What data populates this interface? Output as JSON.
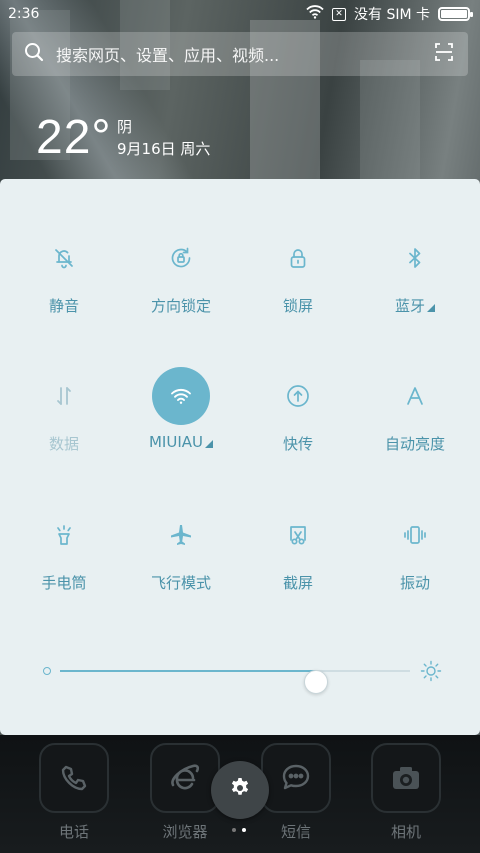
{
  "status_bar": {
    "time": "2:36",
    "carrier": "没有 SIM 卡",
    "battery_level": 1.0
  },
  "search": {
    "placeholder": "搜索网页、设置、应用、视频..."
  },
  "weather": {
    "temperature": "22°",
    "condition": "阴",
    "date": "9月16日 周六"
  },
  "quick_settings": {
    "tiles": [
      {
        "label": "静音",
        "icon": "bell-off-icon"
      },
      {
        "label": "方向锁定",
        "icon": "rotation-lock-icon"
      },
      {
        "label": "锁屏",
        "icon": "lock-icon"
      },
      {
        "label": "蓝牙",
        "icon": "bluetooth-icon"
      },
      {
        "label": "数据",
        "icon": "mobile-data-icon"
      },
      {
        "label": "MIUIAU",
        "icon": "wifi-icon"
      },
      {
        "label": "快传",
        "icon": "share-upload-icon"
      },
      {
        "label": "自动亮度",
        "icon": "auto-brightness-icon"
      },
      {
        "label": "手电筒",
        "icon": "flashlight-icon"
      },
      {
        "label": "飞行模式",
        "icon": "airplane-icon"
      },
      {
        "label": "截屏",
        "icon": "screenshot-icon"
      },
      {
        "label": "振动",
        "icon": "vibrate-icon"
      }
    ],
    "brightness_level": 0.73
  },
  "dock": {
    "apps": [
      {
        "label": "电话",
        "icon": "phone-icon"
      },
      {
        "label": "浏览器",
        "icon": "browser-icon"
      },
      {
        "label": "短信",
        "icon": "messages-icon"
      },
      {
        "label": "相机",
        "icon": "camera-icon"
      }
    ]
  },
  "colors": {
    "accent": "#6bb6cd",
    "tile_text": "#4b93aa",
    "panel_bg": "#e8f0f2"
  }
}
